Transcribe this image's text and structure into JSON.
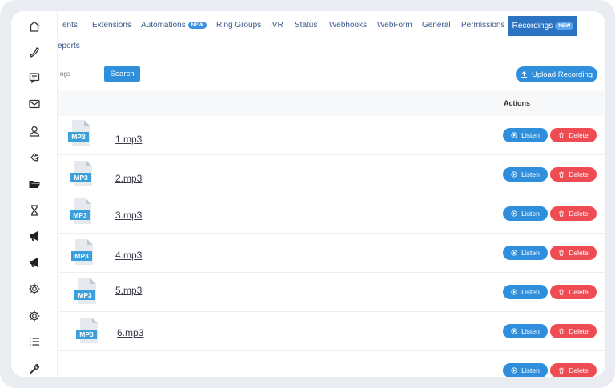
{
  "sidebar": {
    "items": [
      {
        "icon": "home-icon"
      },
      {
        "icon": "phone-icon"
      },
      {
        "icon": "message-icon"
      },
      {
        "icon": "mail-icon"
      },
      {
        "icon": "user-icon"
      },
      {
        "icon": "hand-icon"
      },
      {
        "icon": "folder-icon"
      },
      {
        "icon": "hourglass-icon"
      },
      {
        "icon": "megaphone-icon"
      },
      {
        "icon": "megaphone-icon"
      },
      {
        "icon": "gear-icon"
      },
      {
        "icon": "gear-icon"
      },
      {
        "icon": "list-icon"
      },
      {
        "icon": "wrench-icon"
      }
    ]
  },
  "tabs": {
    "items": [
      {
        "label": "ents"
      },
      {
        "label": "Extensions"
      },
      {
        "label": "Automations",
        "badge": "NEW"
      },
      {
        "label": "Ring Groups"
      },
      {
        "label": "IVR"
      },
      {
        "label": "Status"
      },
      {
        "label": "Webhooks"
      },
      {
        "label": "WebForm"
      },
      {
        "label": "General"
      },
      {
        "label": "Permissions"
      }
    ],
    "active": {
      "label": "Recordings",
      "badge": "NEW"
    },
    "second_row": "eports"
  },
  "search": {
    "placeholder": "ngs",
    "button": "Search"
  },
  "upload": {
    "label": "Upload Recording"
  },
  "table": {
    "actions_header": "Actions",
    "file_badge": "MP3",
    "listen_label": "Listen",
    "delete_label": "Delete",
    "rows": [
      {
        "name": "1.mp3"
      },
      {
        "name": "2.mp3"
      },
      {
        "name": "3.mp3"
      },
      {
        "name": "4.mp3"
      },
      {
        "name": "5.mp3"
      },
      {
        "name": "6.mp3"
      }
    ]
  },
  "colors": {
    "primary": "#2f8fdc",
    "danger": "#ef4b53",
    "active_tab": "#2c73c4"
  }
}
